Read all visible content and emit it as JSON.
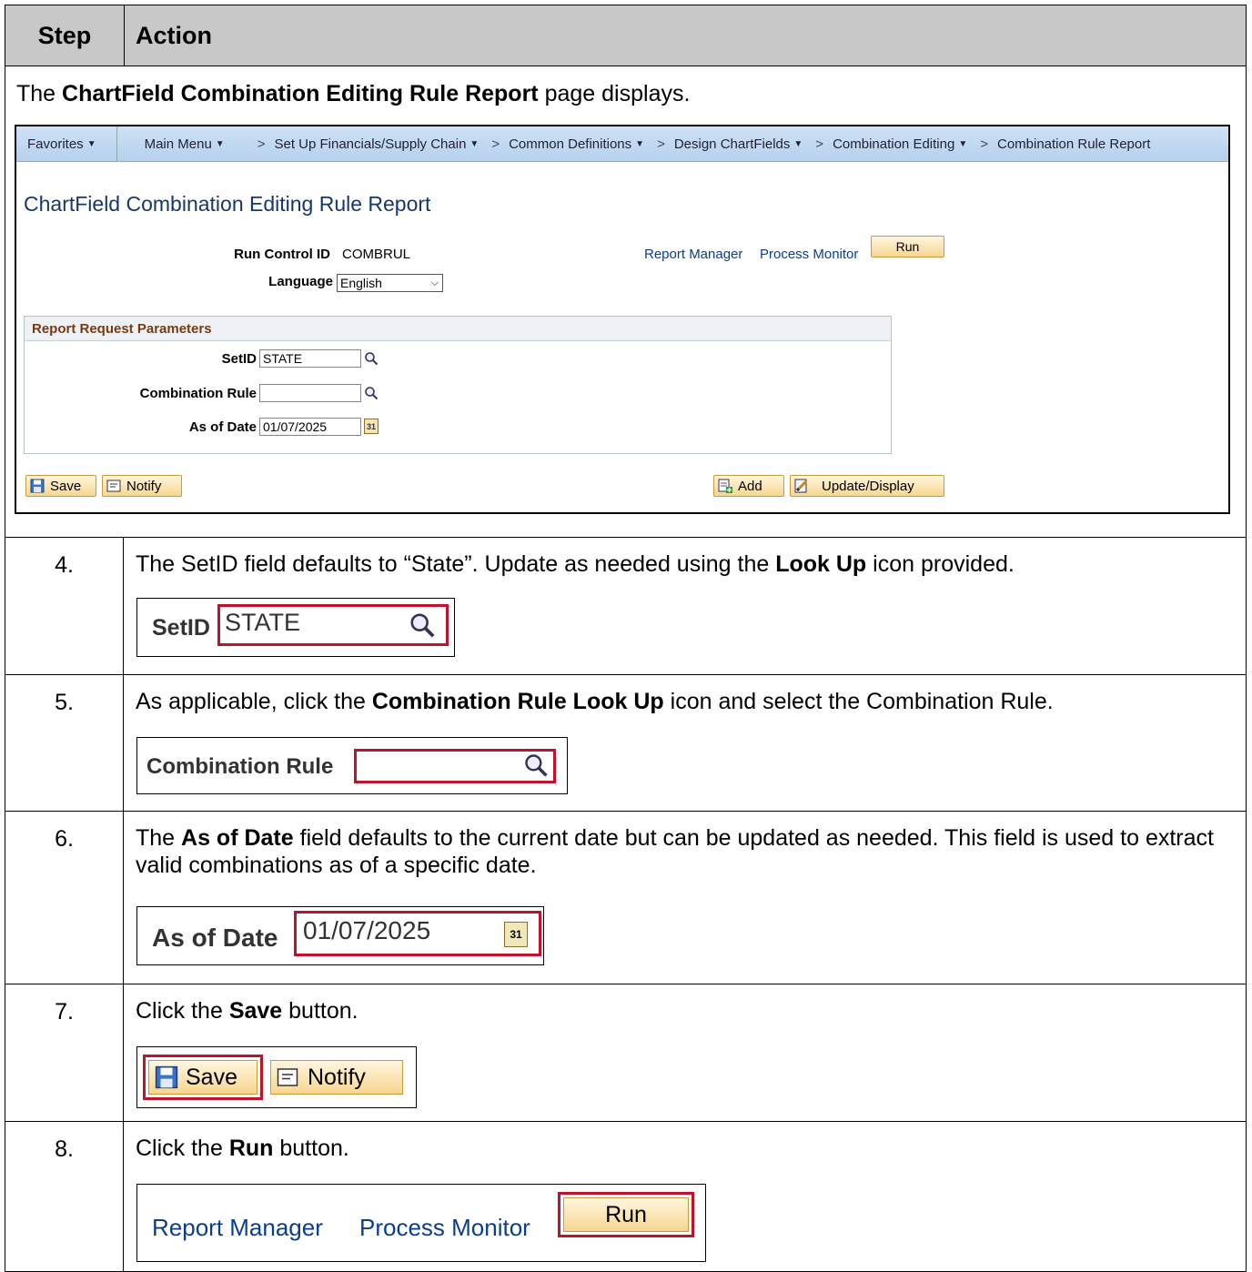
{
  "header": {
    "step": "Step",
    "action": "Action"
  },
  "intro": {
    "pre": "The ",
    "bold": "ChartField Combination Editing Rule Report",
    "post": " page displays."
  },
  "screenshot": {
    "nav": {
      "favorites": "Favorites",
      "main_menu": "Main Menu",
      "crumbs": [
        "Set Up Financials/Supply Chain",
        "Common Definitions",
        "Design ChartFields",
        "Combination Editing",
        "Combination Rule Report"
      ]
    },
    "title": "ChartField Combination Editing Rule Report",
    "run_control_label": "Run Control ID",
    "run_control_value": "COMBRUL",
    "language_label": "Language",
    "language_value": "English",
    "report_manager": "Report Manager",
    "process_monitor": "Process Monitor",
    "run_label": "Run",
    "group_title": "Report Request Parameters",
    "setid_label": "SetID",
    "setid_value": "STATE",
    "combo_rule_label": "Combination Rule",
    "combo_rule_value": "",
    "as_of_label": "As of Date",
    "as_of_value": "01/07/2025",
    "save_label": "Save",
    "notify_label": "Notify",
    "add_label": "Add",
    "update_label": "Update/Display",
    "calendar_glyph": "31"
  },
  "steps": [
    {
      "num": "4.",
      "t1": "The SetID field defaults to “State”.  Update as needed using the ",
      "b1": "Look Up",
      "t2": " icon provided.",
      "snip": {
        "label": "SetID",
        "value": "STATE"
      }
    },
    {
      "num": "5.",
      "t1": "As applicable, click the ",
      "b1": "Combination Rule Look Up",
      "t2": " icon and select the Combination Rule.",
      "snip": {
        "label": "Combination Rule",
        "value": ""
      }
    },
    {
      "num": "6.",
      "t0": "The ",
      "b1": "As of Date",
      "t1": " field defaults to the current date but can be updated as needed.  This field is used to extract valid combinations as of a specific date.",
      "snip": {
        "label": "As of Date",
        "value": "01/07/2025",
        "cal": "31"
      }
    },
    {
      "num": "7.",
      "t0": "Click the ",
      "b1": "Save",
      "t1": " button.",
      "snip": {
        "save": "Save",
        "notify": "Notify"
      }
    },
    {
      "num": "8.",
      "t0": "Click the ",
      "b1": "Run",
      "t1": " button.",
      "snip": {
        "report_manager": "Report Manager",
        "process_monitor": "Process Monitor",
        "run": "Run"
      }
    }
  ],
  "colors": {
    "highlight": "#c0122b",
    "header_bg": "#c8c8c8",
    "nav_bg": "#b6d0ee",
    "button_bg": "#f7d690",
    "link": "#0b3f8a"
  }
}
